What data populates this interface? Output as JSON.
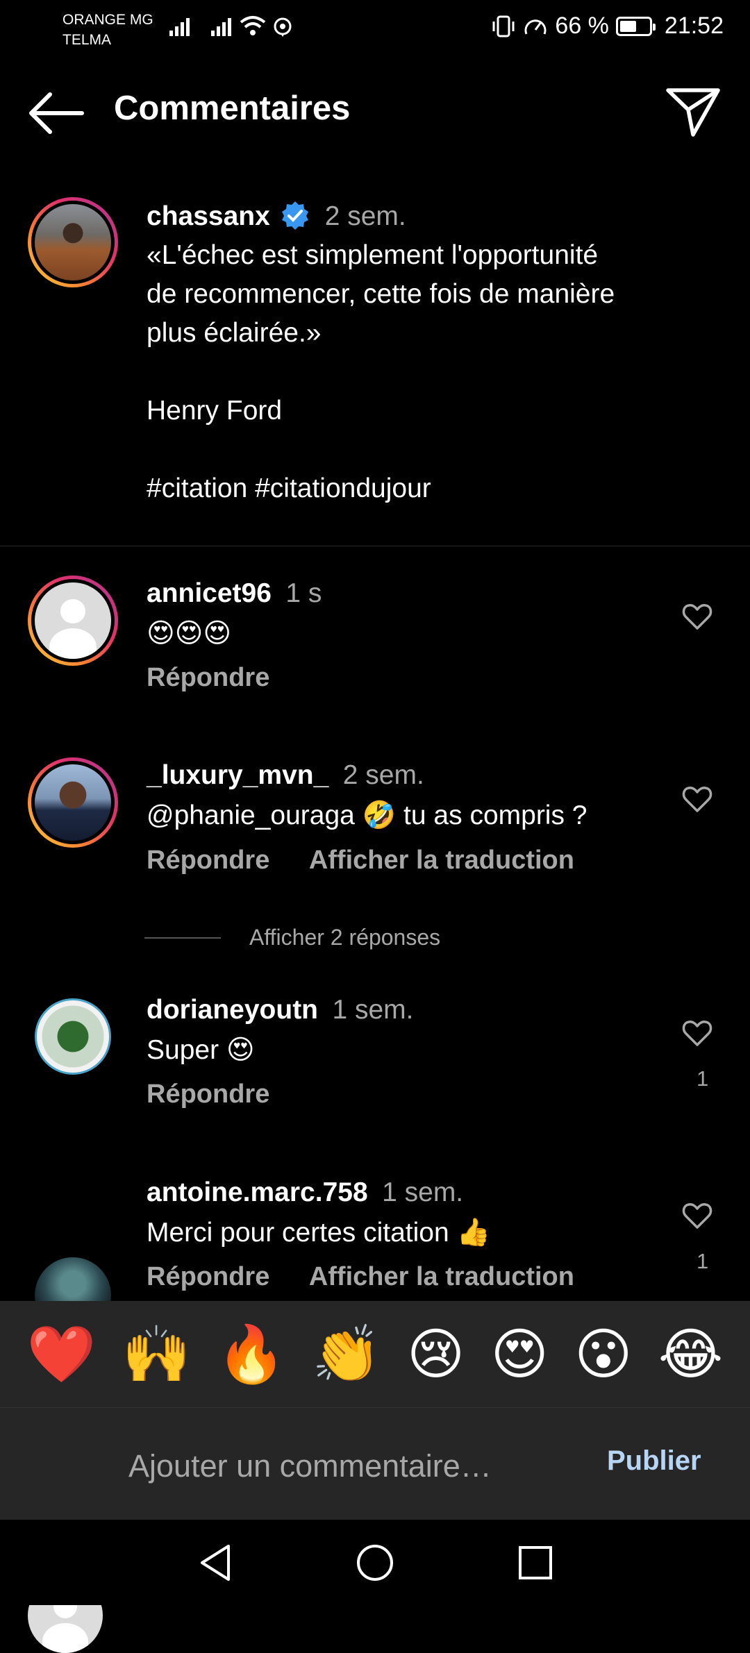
{
  "status_bar": {
    "carrier_line1": "ORANGE MG",
    "carrier_line2": "TELMA",
    "battery": "66 %",
    "battery_level": 0.66,
    "time": "21:52"
  },
  "header": {
    "title": "Commentaires",
    "back_icon": "arrow-left-icon",
    "share_icon": "paper-plane-icon"
  },
  "caption": {
    "username": "chassanx",
    "time": "2 sem.",
    "text": "«L'échec est simplement l'opportunité\nde recommencer, cette fois de manière\nplus éclairée.»\n\nHenry Ford\n\n#citation #citationdujour",
    "verified_icon": "verified-badge-icon"
  },
  "comments": [
    {
      "username": "annicet96",
      "time": "1 s",
      "text": "😍😍😍",
      "reply": "Répondre"
    },
    {
      "username": "_luxury_mvn_",
      "time": "2 sem.",
      "text": "@phanie_ouraga 🤣 tu as compris ?",
      "reply": "Répondre",
      "translate": "Afficher la traduction",
      "view_replies": "Afficher 2 réponses"
    },
    {
      "username": "dorianeyoutn",
      "time": "1 sem.",
      "text": "Super 😍",
      "reply": "Répondre",
      "likes": "1"
    },
    {
      "username": "antoine.marc.758",
      "time": "1 sem.",
      "text": "Merci pour certes citation 👍",
      "reply": "Répondre",
      "translate": "Afficher la traduction",
      "likes": "1"
    }
  ],
  "reactions": [
    "❤️",
    "🙌",
    "🔥",
    "👏",
    "😢",
    "😍",
    "😮",
    "😂"
  ],
  "composer": {
    "placeholder": "Ajouter un commentaire…",
    "publish": "Publier"
  },
  "colors": {
    "background": "#000000",
    "secondary_text": "#a8a8a8",
    "verified": "#3897f0",
    "publish": "#b7d6f5",
    "bar": "#262626"
  }
}
